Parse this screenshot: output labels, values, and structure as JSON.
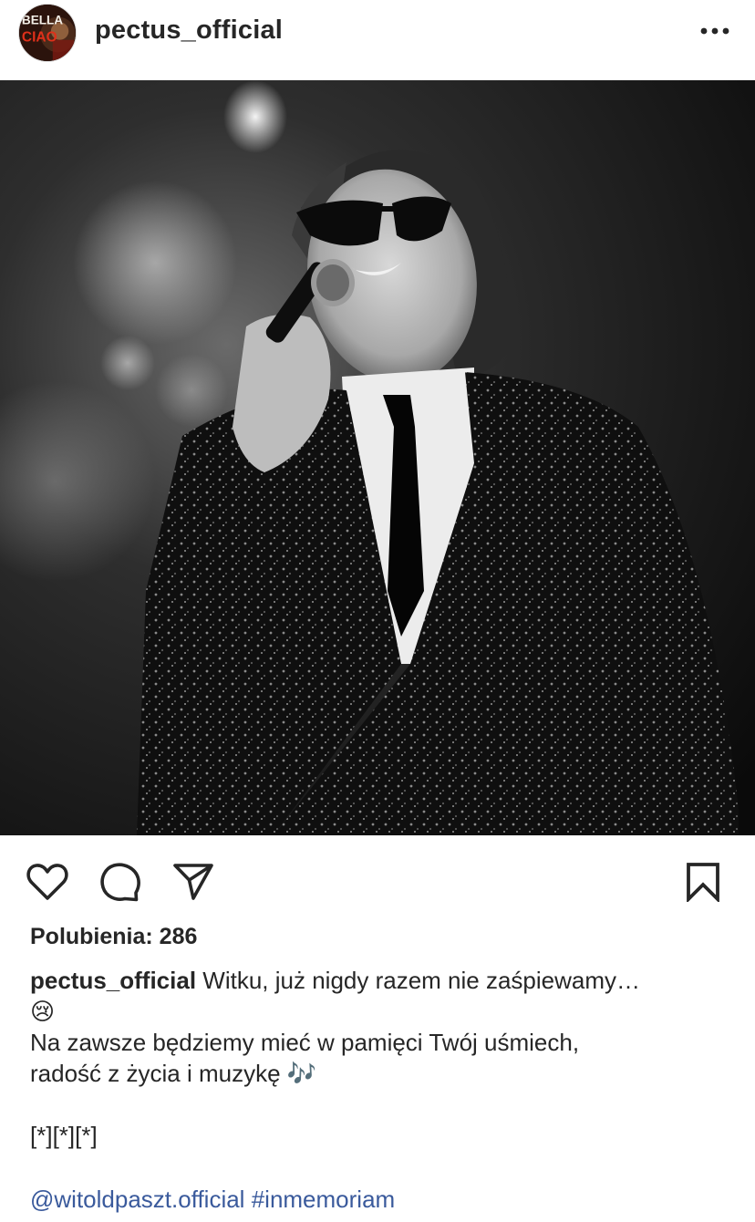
{
  "header": {
    "username": "pectus_official",
    "avatar_text": "BELLA CIAO",
    "more_icon": "more-horizontal-icon"
  },
  "post": {
    "image_description_icon": "concert-photo",
    "likes_label": "Polubienia: 286",
    "caption": {
      "username": "pectus_official",
      "line1": "Witku, już nigdy razem nie zaśpiewamy…",
      "line1_emoji": "😢",
      "line2": "Na zawsze będziemy mieć w pamięci Twój  uśmiech,",
      "line3": "radość z życia i muzykę 🎶",
      "line4": "[*][*][*]",
      "mention": "@witoldpaszt.official",
      "hashtag": "#inmemoriam"
    }
  },
  "actions": {
    "like_icon": "heart-icon",
    "comment_icon": "comment-icon",
    "share_icon": "send-icon",
    "save_icon": "bookmark-icon"
  },
  "colors": {
    "text": "#262626",
    "link": "#385185",
    "background": "#ffffff"
  }
}
